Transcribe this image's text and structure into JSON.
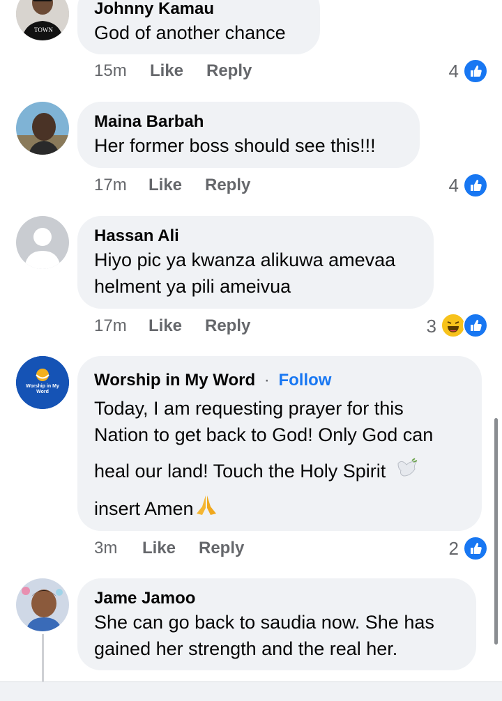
{
  "comments": [
    {
      "author": "Johnny Kamau",
      "lines": [
        "God of another chance"
      ],
      "time": "15m",
      "like_label": "Like",
      "reply_label": "Reply",
      "reaction_count": "4"
    },
    {
      "author": "Maina Barbah",
      "lines": [
        "Her former boss should see this!!!"
      ],
      "time": "17m",
      "like_label": "Like",
      "reply_label": "Reply",
      "reaction_count": "4"
    },
    {
      "author": "Hassan Ali",
      "lines": [
        "Hiyo pic ya kwanza alikuwa amevaa",
        "helment ya pili ameivua"
      ],
      "time": "17m",
      "like_label": "Like",
      "reply_label": "Reply",
      "reaction_count": "3"
    },
    {
      "author": "Worship in My Word",
      "separator": "·",
      "follow_label": "Follow",
      "avatar_text": "Worship in My Word",
      "lines": [
        "Today, I am requesting prayer for this",
        "Nation to get back to God! Only God can",
        "heal our land! Touch the Holy Spirit",
        "insert Amen"
      ],
      "time": "3m",
      "like_label": "Like",
      "reply_label": "Reply",
      "reaction_count": "2"
    },
    {
      "author": "Jame Jamoo",
      "lines": [
        "She can go back to saudia now. She has",
        "gained her strength and the real her."
      ]
    }
  ],
  "icons": {
    "like_reaction": "like-reaction-icon",
    "haha_reaction": "haha-reaction-icon",
    "dove": "dove-emoji",
    "praying_hands": "praying-hands-emoji"
  },
  "colors": {
    "bubble": "#f0f2f5",
    "link": "#1877f2",
    "meta": "#65676b",
    "haha": "#f7c21b"
  }
}
